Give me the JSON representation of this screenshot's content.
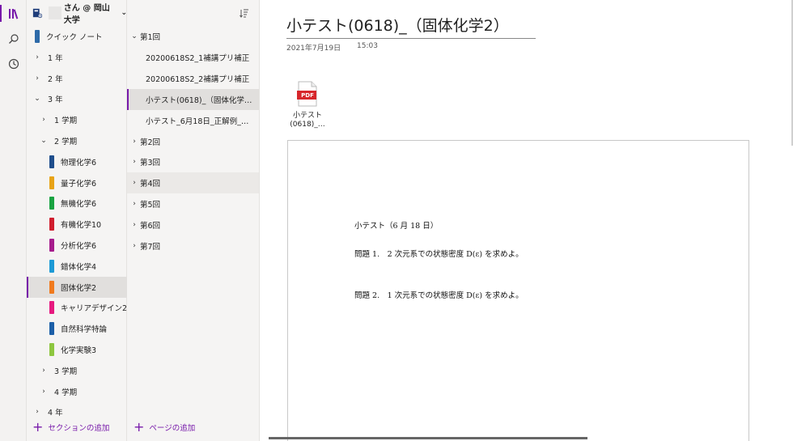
{
  "notebook": {
    "name": "さん @ 岡山大学"
  },
  "sections": [
    {
      "label": "クイック ノート",
      "kind": "section",
      "color": "#2e6aa8",
      "indent": 0
    },
    {
      "label": "1 年",
      "kind": "group",
      "expanded": false,
      "indent": 0
    },
    {
      "label": "2 年",
      "kind": "group",
      "expanded": false,
      "indent": 0
    },
    {
      "label": "3 年",
      "kind": "group",
      "expanded": true,
      "indent": 0
    },
    {
      "label": "1 学期",
      "kind": "group",
      "expanded": false,
      "indent": 1
    },
    {
      "label": "2 学期",
      "kind": "group",
      "expanded": true,
      "indent": 1
    },
    {
      "label": "物理化学6",
      "kind": "section",
      "color": "#1f4e8c",
      "indent": 2
    },
    {
      "label": "量子化学6",
      "kind": "section",
      "color": "#e8a317",
      "indent": 2
    },
    {
      "label": "無機化学6",
      "kind": "section",
      "color": "#19a341",
      "indent": 2
    },
    {
      "label": "有機化学10",
      "kind": "section",
      "color": "#d01e2e",
      "indent": 2
    },
    {
      "label": "分析化学6",
      "kind": "section",
      "color": "#a61c8c",
      "indent": 2
    },
    {
      "label": "錯体化学4",
      "kind": "section",
      "color": "#1d9ad6",
      "indent": 2
    },
    {
      "label": "固体化学2",
      "kind": "section",
      "color": "#f07a1e",
      "indent": 2,
      "selected": true
    },
    {
      "label": "キャリアデザイン2",
      "kind": "section",
      "color": "#e6197f",
      "indent": 2
    },
    {
      "label": "自然科学特論",
      "kind": "section",
      "color": "#1c5fa8",
      "indent": 2
    },
    {
      "label": "化学実験3",
      "kind": "section",
      "color": "#8dc63f",
      "indent": 2
    },
    {
      "label": "3 学期",
      "kind": "group",
      "expanded": false,
      "indent": 1
    },
    {
      "label": "4 学期",
      "kind": "group",
      "expanded": false,
      "indent": 1
    },
    {
      "label": "4 年",
      "kind": "group",
      "expanded": false,
      "indent": 0
    }
  ],
  "add_section_label": "セクションの追加",
  "pages": [
    {
      "label": "第1回",
      "kind": "group",
      "expanded": true,
      "indent": 0
    },
    {
      "label": "20200618S2_1補講プリ補正",
      "kind": "page",
      "indent": 1
    },
    {
      "label": "20200618S2_2補講プリ補正",
      "kind": "page",
      "indent": 1
    },
    {
      "label": "小テスト(0618)_（固体化学2）",
      "kind": "page",
      "indent": 1,
      "selected": true
    },
    {
      "label": "小テスト_6月18日_正解例_固体...",
      "kind": "page",
      "indent": 1
    },
    {
      "label": "第2回",
      "kind": "group",
      "expanded": false,
      "indent": 0
    },
    {
      "label": "第3回",
      "kind": "group",
      "expanded": false,
      "indent": 0
    },
    {
      "label": "第4回",
      "kind": "group",
      "expanded": false,
      "indent": 0,
      "hover": true
    },
    {
      "label": "第5回",
      "kind": "group",
      "expanded": false,
      "indent": 0
    },
    {
      "label": "第6回",
      "kind": "group",
      "expanded": false,
      "indent": 0
    },
    {
      "label": "第7回",
      "kind": "group",
      "expanded": false,
      "indent": 0
    }
  ],
  "add_page_label": "ページの追加",
  "page": {
    "title": "小テスト(0618)_（固体化学2）",
    "date": "2021年7月19日",
    "time": "15:03",
    "attachment": {
      "badge": "PDF",
      "label_line1": "小テスト",
      "label_line2": "(0618)_…"
    },
    "document": {
      "heading": "小テスト（6 月 18 日）",
      "q1": "問題 1.　2 次元系での状態密度 D(ε) を求めよ。",
      "q2": "問題 2.　1 次元系での状態密度 D(ε) を求めよ。"
    }
  },
  "colors": {
    "accent": "#7719aa",
    "pdf_red": "#d7262b"
  }
}
